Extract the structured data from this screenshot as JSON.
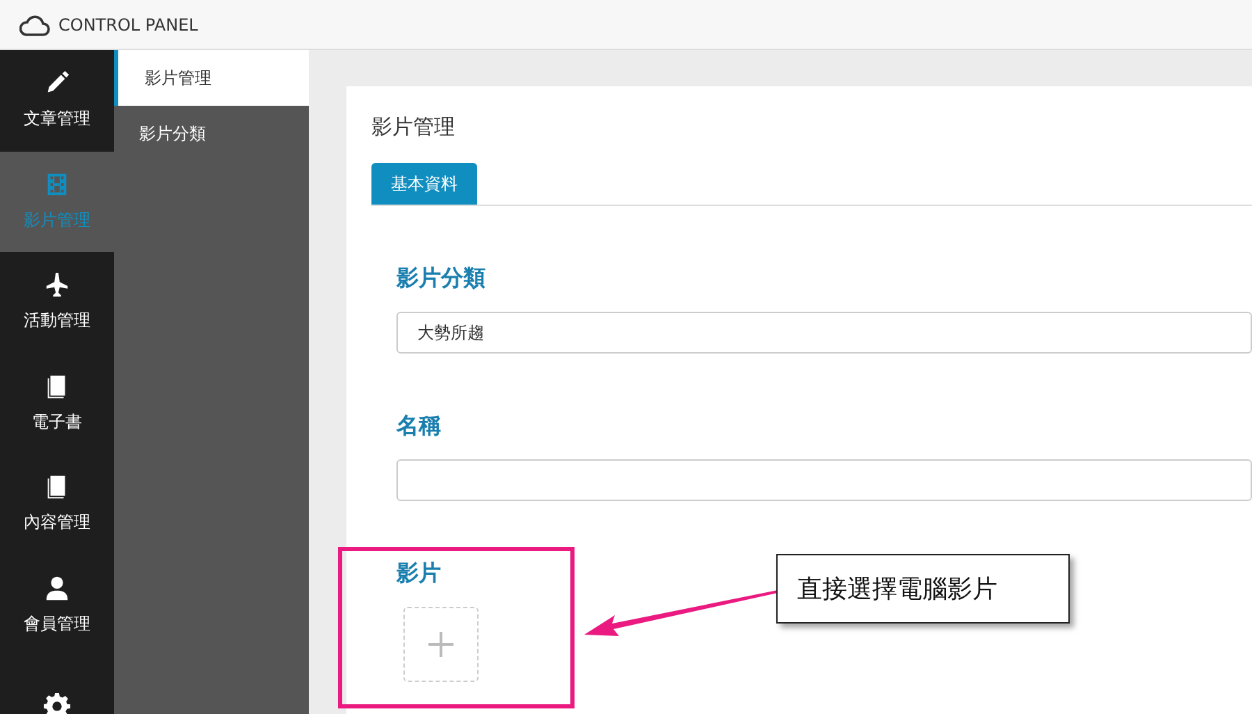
{
  "header": {
    "title": "CONTROL PANEL"
  },
  "nav": [
    {
      "label": "文章管理",
      "selected": false
    },
    {
      "label": "影片管理",
      "selected": true
    },
    {
      "label": "活動管理",
      "selected": false
    },
    {
      "label": "電子書",
      "selected": false
    },
    {
      "label": "內容管理",
      "selected": false
    },
    {
      "label": "會員管理",
      "selected": false
    },
    {
      "selected": false
    }
  ],
  "subnav": [
    {
      "label": "影片管理",
      "selected": true
    },
    {
      "label": "影片分類",
      "selected": false
    }
  ],
  "panel": {
    "title": "影片管理",
    "tabs": [
      {
        "label": "基本資料",
        "selected": true
      }
    ],
    "fields": [
      {
        "kind": "select",
        "label": "影片分類",
        "value": "大勢所趨"
      },
      {
        "kind": "text",
        "label": "名稱"
      },
      {
        "kind": "upload",
        "label": "影片"
      }
    ]
  },
  "callout": {
    "text": "直接選擇電腦影片"
  }
}
